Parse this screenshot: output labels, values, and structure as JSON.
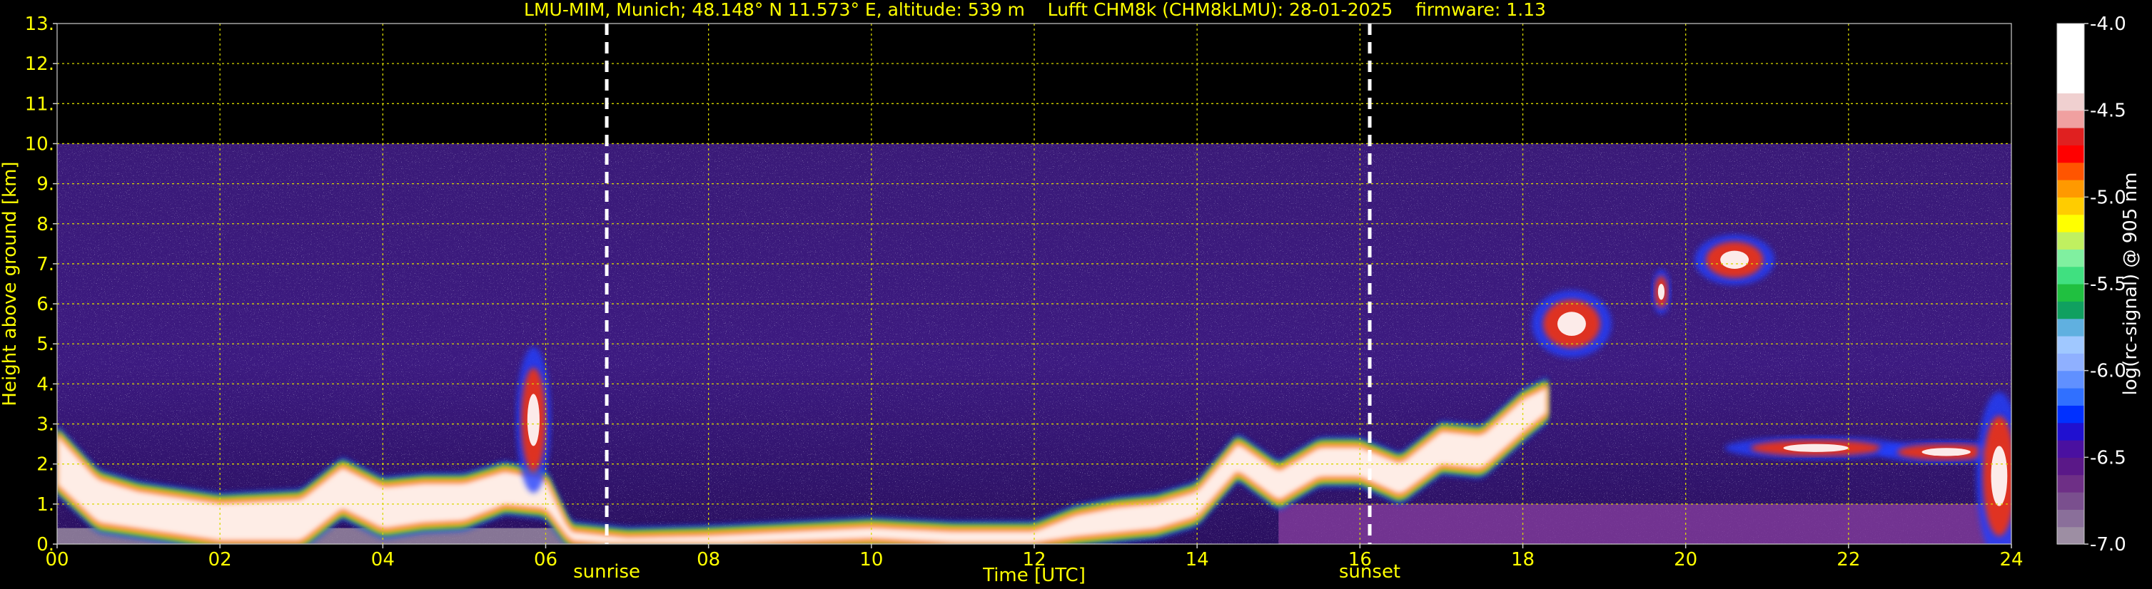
{
  "chart_data": {
    "type": "heatmap",
    "title": "LMU-MIM, Munich; 48.148° N 11.573° E, altitude: 539 m    Lufft CHM8k (CHM8kLMU): 28-01-2025    firmware: 1.13",
    "xlabel": "Time [UTC]",
    "ylabel": "Height above ground [km]",
    "xlim": [
      0,
      24
    ],
    "ylim": [
      0,
      13
    ],
    "x_ticks": [
      "00",
      "02",
      "04",
      "06",
      "08",
      "10",
      "12",
      "14",
      "16",
      "18",
      "20",
      "22",
      "24"
    ],
    "y_ticks": [
      "0.",
      "1.",
      "2.",
      "3.",
      "4.",
      "5.",
      "6.",
      "7.",
      "8.",
      "9.",
      "10.",
      "11.",
      "12.",
      "13."
    ],
    "grid": true,
    "signal_top_km": 10.0,
    "colorbar": {
      "label": "log(rc-signal) @ 905 nm",
      "range": [
        -7.0,
        -4.0
      ],
      "ticks": [
        "-4.0",
        "-4.5",
        "-5.0",
        "-5.5",
        "-6.0",
        "-6.5",
        "-7.0"
      ],
      "colors": [
        "#9d8ea3",
        "#8a6f9a",
        "#7a4f8e",
        "#6e2f86",
        "#5a1888",
        "#4a10a0",
        "#2010d0",
        "#0030ff",
        "#3070ff",
        "#6090ff",
        "#8fb0ff",
        "#a0c8ff",
        "#60b0e0",
        "#10a060",
        "#20c040",
        "#40e080",
        "#80f0a0",
        "#c0f060",
        "#ffff00",
        "#ffcc00",
        "#ff9900",
        "#ff5500",
        "#ff0000",
        "#e02020",
        "#f0a0a0",
        "#f0d0d0",
        "#ffffff",
        "#ffffff",
        "#ffffff",
        "#ffffff"
      ]
    },
    "events": [
      {
        "label": "sunrise",
        "time": 6.75
      },
      {
        "label": "sunset",
        "time": 16.12
      }
    ],
    "boundary_layer_top": {
      "x": [
        0,
        0.5,
        1,
        2,
        3,
        3.5,
        4,
        4.5,
        5,
        5.5,
        6,
        6.3,
        7,
        8,
        9,
        10,
        11,
        12,
        12.5,
        13,
        13.5,
        14,
        14.5,
        15,
        15.5,
        16,
        16.5,
        17,
        17.5,
        18,
        18.3
      ],
      "y": [
        2.7,
        1.6,
        1.3,
        1.0,
        1.1,
        1.9,
        1.4,
        1.5,
        1.5,
        1.8,
        1.6,
        0.3,
        0.15,
        0.2,
        0.3,
        0.4,
        0.3,
        0.3,
        0.7,
        0.9,
        1.0,
        1.3,
        2.5,
        1.8,
        2.4,
        2.4,
        2.0,
        2.8,
        2.7,
        3.6,
        3.9
      ]
    },
    "boundary_layer_thickness": {
      "x": [
        0,
        1,
        2,
        3,
        4,
        5,
        6,
        6.3,
        7,
        10,
        12,
        12.5,
        13,
        14,
        15,
        16,
        17,
        18,
        18.3
      ],
      "y": [
        1.2,
        0.9,
        0.9,
        1.0,
        1.0,
        0.9,
        0.7,
        0.2,
        0.15,
        0.25,
        0.25,
        0.5,
        0.6,
        0.6,
        0.7,
        0.7,
        0.8,
        0.8,
        0.6
      ]
    },
    "cloud_features": [
      {
        "time": 5.85,
        "height": 3.1,
        "dx": 0.15,
        "dy": 1.3
      },
      {
        "time": 18.6,
        "height": 5.5,
        "dx": 0.35,
        "dy": 0.6
      },
      {
        "time": 19.7,
        "height": 6.3,
        "dx": 0.08,
        "dy": 0.4
      },
      {
        "time": 20.6,
        "height": 7.1,
        "dx": 0.35,
        "dy": 0.45
      },
      {
        "time": 21.6,
        "height": 2.4,
        "dx": 0.8,
        "dy": 0.2
      },
      {
        "time": 23.2,
        "height": 2.3,
        "dx": 0.6,
        "dy": 0.2
      },
      {
        "time": 23.85,
        "height": 1.7,
        "dx": 0.2,
        "dy": 1.5
      }
    ]
  }
}
